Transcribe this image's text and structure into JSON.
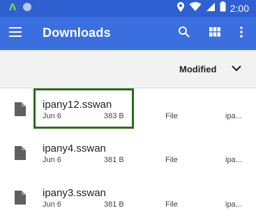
{
  "status_bar": {
    "time": "2:00",
    "icons": [
      "android-icon",
      "circle-icon",
      "location-icon",
      "wifi-icon",
      "signal-icon",
      "battery-icon"
    ]
  },
  "app_bar": {
    "title": "Downloads",
    "icons": [
      "menu-icon",
      "search-icon",
      "grid-view-icon",
      "more-vert-icon"
    ]
  },
  "sort_bar": {
    "label": "Modified",
    "icon": "chevron-down-icon"
  },
  "files": [
    {
      "name": "ipany12.sswan",
      "date": "Jun 6",
      "size": "383 B",
      "type": "File",
      "path": "ipa..."
    },
    {
      "name": "ipany4.sswan",
      "date": "Jun 6",
      "size": "381 B",
      "type": "File",
      "path": "ipa..."
    },
    {
      "name": "ipany3.sswan",
      "date": "Jun 6",
      "size": "381 B",
      "type": "File",
      "path": "ipa..."
    }
  ],
  "colors": {
    "status_bar": "#2f5fd0",
    "app_bar": "#3b6fe0",
    "highlight": "#2e6b1a"
  }
}
